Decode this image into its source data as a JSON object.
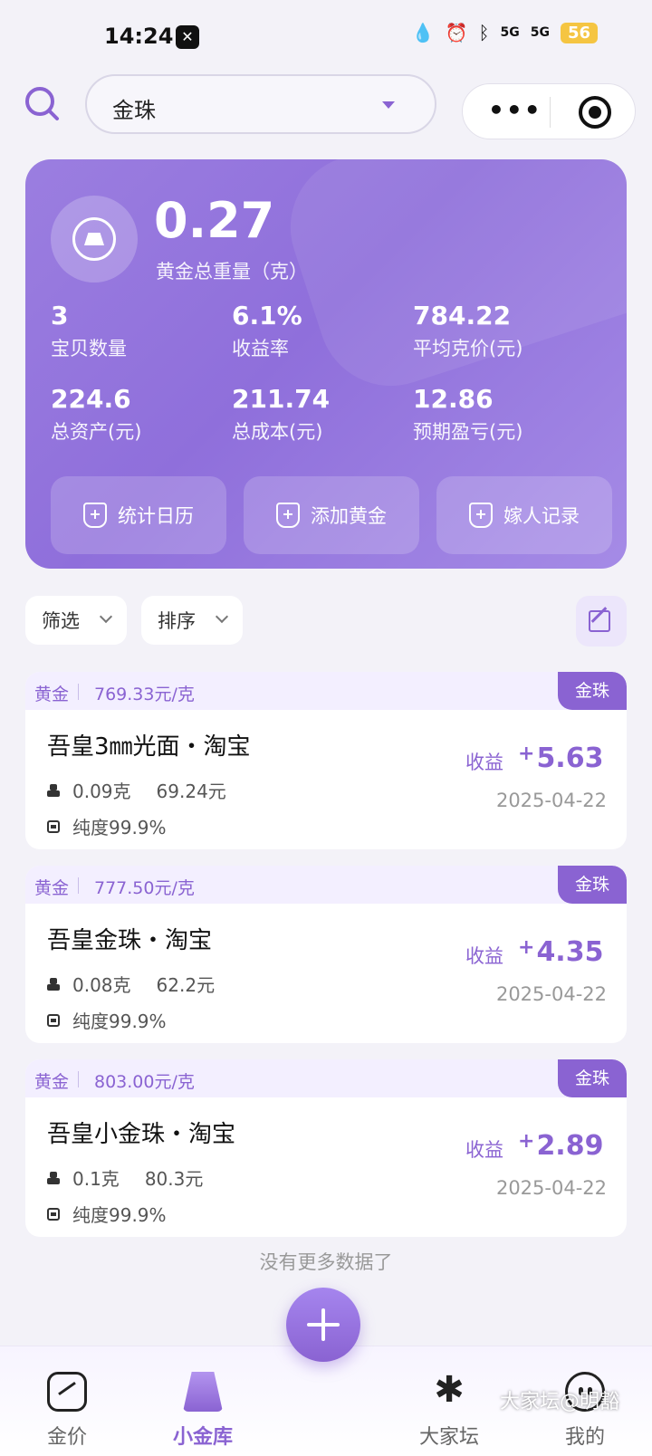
{
  "status_bar": {
    "time": "14:24",
    "signal_1": "5G",
    "signal_2": "5G",
    "battery": "56"
  },
  "header": {
    "selector_value": "金珠"
  },
  "summary": {
    "total_weight": "0.27",
    "total_weight_label": "黄金总重量（克）",
    "stats": [
      {
        "value": "3",
        "label": "宝贝数量"
      },
      {
        "value": "6.1%",
        "label": "收益率"
      },
      {
        "value": "784.22",
        "label": "平均克价(元)"
      },
      {
        "value": "224.6",
        "label": "总资产(元)"
      },
      {
        "value": "211.74",
        "label": "总成本(元)"
      },
      {
        "value": "12.86",
        "label": "预期盈亏(元)"
      }
    ],
    "actions": [
      "统计日历",
      "添加黄金",
      "嫁人记录"
    ]
  },
  "filters": {
    "filter_label": "筛选",
    "sort_label": "排序"
  },
  "items": [
    {
      "metal": "黄金",
      "unit_price": "769.33元/克",
      "tag": "金珠",
      "name": "吾皇3㎜光面・淘宝",
      "weight": "0.09克",
      "cost": "69.24元",
      "purity": "纯度99.9%",
      "profit_label": "收益",
      "profit_sign": "+",
      "profit": "5.63",
      "date": "2025-04-22"
    },
    {
      "metal": "黄金",
      "unit_price": "777.50元/克",
      "tag": "金珠",
      "name": "吾皇金珠・淘宝",
      "weight": "0.08克",
      "cost": "62.2元",
      "purity": "纯度99.9%",
      "profit_label": "收益",
      "profit_sign": "+",
      "profit": "4.35",
      "date": "2025-04-22"
    },
    {
      "metal": "黄金",
      "unit_price": "803.00元/克",
      "tag": "金珠",
      "name": "吾皇小金珠・淘宝",
      "weight": "0.1克",
      "cost": "80.3元",
      "purity": "纯度99.9%",
      "profit_label": "收益",
      "profit_sign": "+",
      "profit": "2.89",
      "date": "2025-04-22"
    }
  ],
  "list_end_text": "没有更多数据了",
  "bottom_nav": [
    {
      "label": "金价",
      "icon": "trend-chart-icon"
    },
    {
      "label": "小金库",
      "icon": "gold-bar-icon"
    },
    {
      "label": "大家坛",
      "icon": "pinwheel-icon"
    },
    {
      "label": "我的",
      "icon": "face-icon"
    }
  ],
  "watermark": "大家坛@明豁",
  "colors": {
    "accent": "#8a63d2",
    "card_gradient_start": "#9b7ee0",
    "card_gradient_end": "#a58be6"
  }
}
